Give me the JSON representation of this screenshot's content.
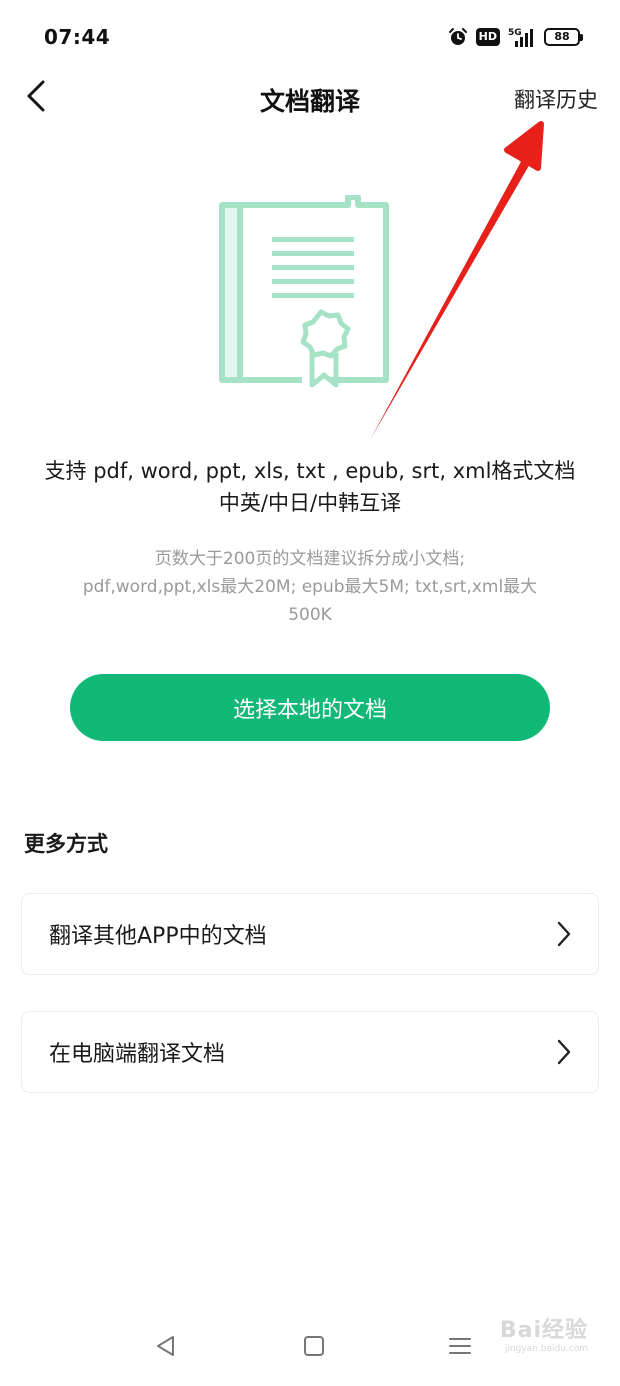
{
  "status_bar": {
    "time": "07:44",
    "hd": "HD",
    "network": "5G",
    "battery": "88"
  },
  "nav": {
    "title": "文档翻译",
    "history_label": "翻译历史"
  },
  "hero": {
    "support_line1": "支持 pdf, word, ppt, xls, txt , epub, srt, xml格式文档",
    "support_line2": "中英/中日/中韩互译",
    "hint_line1": "页数大于200页的文档建议拆分成小文档;",
    "hint_line2": "pdf,word,ppt,xls最大20M;  epub最大5M; txt,srt,xml最大",
    "hint_line3": "500K"
  },
  "primary_button": {
    "label": "选择本地的文档"
  },
  "more": {
    "title": "更多方式",
    "options": [
      {
        "label": "翻译其他APP中的文档"
      },
      {
        "label": "在电脑端翻译文档"
      }
    ]
  },
  "watermark": {
    "main": "Bai经验",
    "sub": "jingyan.baidu.com"
  },
  "colors": {
    "accent": "#12b876",
    "illustration": "#a6e3c6",
    "annotation_arrow": "#e8201a"
  }
}
